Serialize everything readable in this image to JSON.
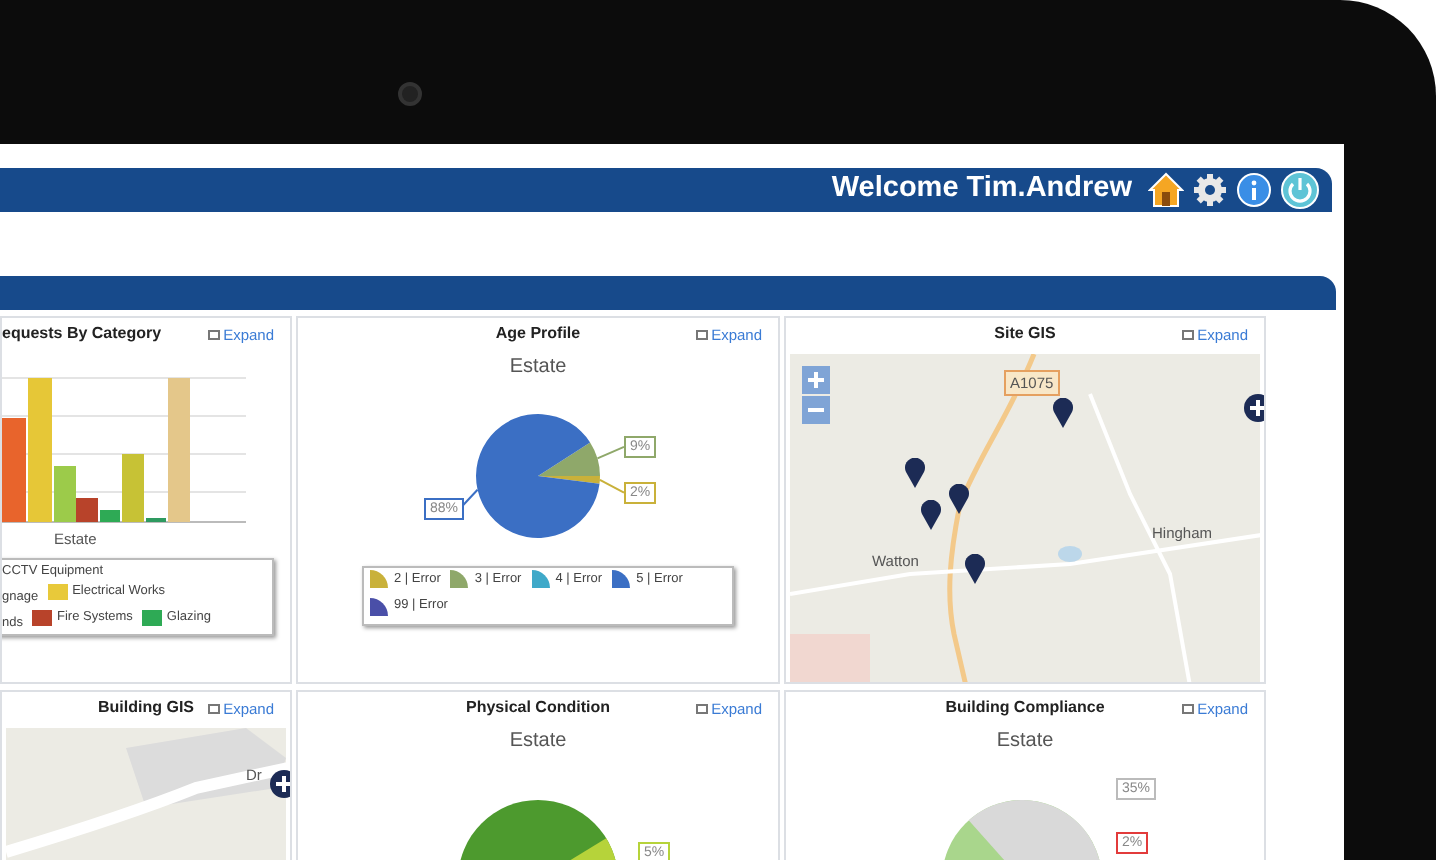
{
  "header": {
    "welcome": "Welcome Tim.Andrew"
  },
  "panels": [
    {
      "kind": "bar",
      "title": "equests By Category",
      "expand": "Expand",
      "xlabel": "Estate",
      "legend_rows": [
        [
          {
            "label": "CCTV Equipment"
          }
        ],
        [
          {
            "label": "gnage"
          },
          {
            "label": "Electrical Works",
            "color": "#e8c93a"
          }
        ],
        [
          {
            "label": "nds"
          },
          {
            "label": "Fire Systems",
            "color": "#b8432a"
          },
          {
            "label": "Glazing",
            "color": "#2eaa55"
          }
        ]
      ]
    },
    {
      "kind": "pie",
      "title": "Age Profile",
      "expand": "Expand",
      "chart_data": {
        "type": "pie",
        "title": "Estate",
        "categories": [
          "2 | Error",
          "3 | Error",
          "4 | Error",
          "5 | Error",
          "99 | Error"
        ],
        "colors": [
          "#c9b13a",
          "#8fa86a",
          "#3fa9c9",
          "#3b6fc4",
          "#4a4fa8"
        ],
        "values": [
          2,
          9,
          0,
          88,
          0
        ],
        "value_labels": [
          "2%",
          "9%",
          null,
          "88%",
          null
        ]
      }
    },
    {
      "kind": "map",
      "title": "Site GIS",
      "expand": "Expand",
      "places": [
        {
          "label": "A1075",
          "kind": "road"
        },
        {
          "label": "Watton",
          "kind": "town"
        },
        {
          "label": "Hingham",
          "kind": "town"
        }
      ]
    },
    {
      "kind": "map",
      "title": "Building GIS",
      "expand": "Expand",
      "places": [
        {
          "label": "Dr",
          "kind": "town"
        }
      ]
    },
    {
      "kind": "pie-picture",
      "title": "Physical Condition",
      "expand": "Expand",
      "subtitle": "Estate",
      "labels": [
        "5%"
      ]
    },
    {
      "kind": "pie-picture",
      "title": "Building Compliance",
      "expand": "Expand",
      "subtitle": "Estate",
      "labels": [
        "35%",
        "2%"
      ]
    }
  ]
}
